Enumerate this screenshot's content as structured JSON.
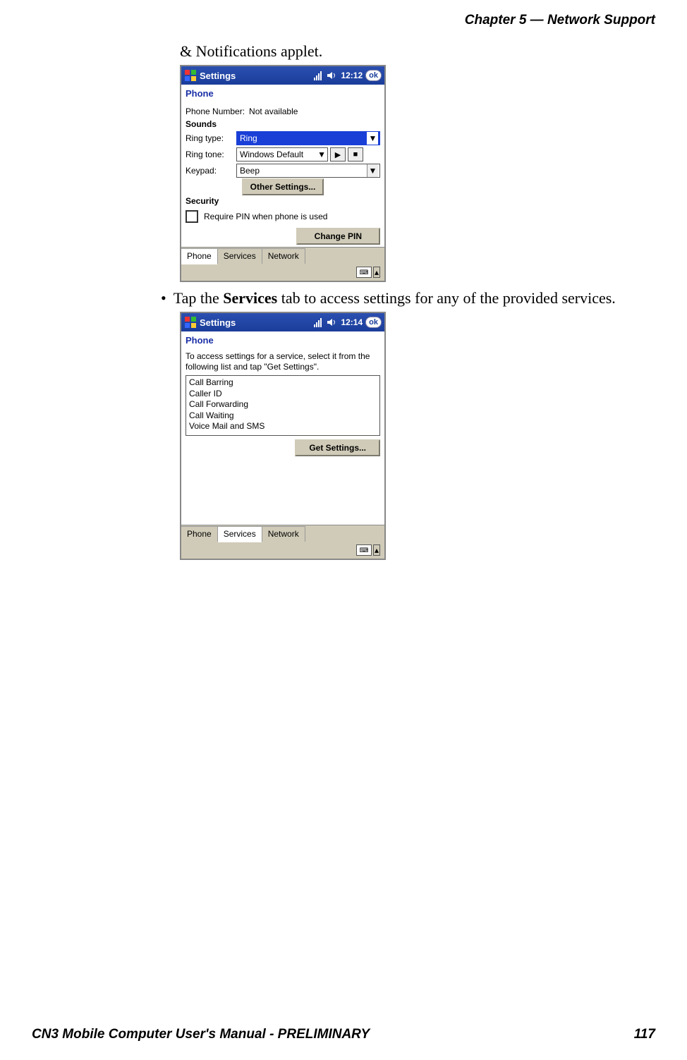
{
  "header": {
    "chapter": "Chapter 5 —  Network Support"
  },
  "body": {
    "line1": "& Notifications applet.",
    "bullet_prefix": "Tap the ",
    "bullet_bold": "Services",
    "bullet_suffix": " tab to access settings for any of the provided services."
  },
  "device1": {
    "title": "Settings",
    "time": "12:12",
    "ok": "ok",
    "app_title": "Phone",
    "phone_number_label": "Phone Number:",
    "phone_number_value": "Not available",
    "sounds_heading": "Sounds",
    "ring_type_label": "Ring type:",
    "ring_type_value": "Ring",
    "ring_tone_label": "Ring tone:",
    "ring_tone_value": "Windows Default",
    "keypad_label": "Keypad:",
    "keypad_value": "Beep",
    "other_settings_btn": "Other Settings...",
    "security_heading": "Security",
    "require_pin_label": "Require PIN when phone is used",
    "change_pin_btn": "Change PIN",
    "tabs": {
      "t1": "Phone",
      "t2": "Services",
      "t3": "Network"
    }
  },
  "device2": {
    "title": "Settings",
    "time": "12:14",
    "ok": "ok",
    "app_title": "Phone",
    "instruction": "To access settings for a service, select it from the following list and tap \"Get Settings\".",
    "services": {
      "s1": "Call Barring",
      "s2": "Caller ID",
      "s3": "Call Forwarding",
      "s4": "Call Waiting",
      "s5": "Voice Mail and SMS"
    },
    "get_settings_btn": "Get Settings...",
    "tabs": {
      "t1": "Phone",
      "t2": "Services",
      "t3": "Network"
    }
  },
  "footer": {
    "left": "CN3 Mobile Computer User's Manual - PRELIMINARY",
    "page": "117"
  }
}
